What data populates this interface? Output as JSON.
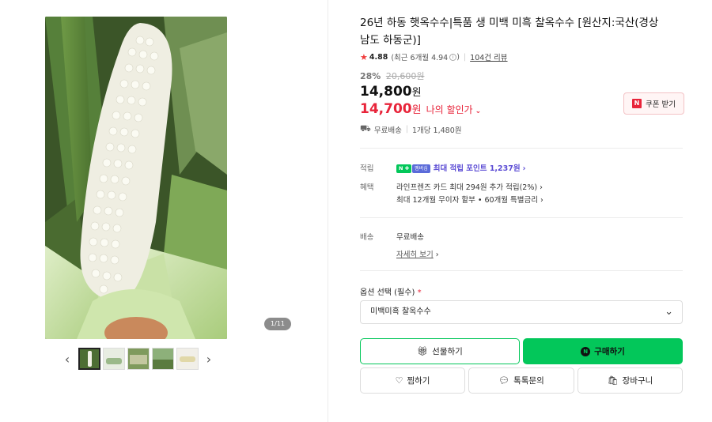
{
  "gallery": {
    "counter": "1/11",
    "prev_arrow": "‹",
    "next_arrow": "›",
    "thumb_count": 5
  },
  "product": {
    "title": "26년 하동 햇옥수수|특품 생 미백 미흑 찰옥수수 [원산지:국산(경상남도 하동군)]",
    "rating": "4.88",
    "rating_recent": "(최근 6개월 4.94",
    "rating_recent_close": ")",
    "review_count": "104건 리뷰",
    "discount": "28%",
    "original_price": "20,600원",
    "price": "14,800",
    "price_unit": "원",
    "my_price": "14,700",
    "my_price_unit": "원",
    "my_price_label": "나의 할인가",
    "coupon_label": "쿠폰 받기",
    "coupon_badge": "N",
    "shipping_free": "무료배송",
    "unit_price": "1개당 1,480원"
  },
  "benefits": {
    "points_label": "적립",
    "points_text": "최대 적립 포인트 1,237원",
    "npay_badge": "N ✚",
    "npay_badge2": "멤버십",
    "benefit_label": "혜택",
    "benefit_1": "라인프렌즈 카드 최대 294원 추가 적립(2%)",
    "benefit_2": "최대 12개월 무이자 할부 • 60개월 특별금리",
    "delivery_label": "배송",
    "delivery_value": "무료배송",
    "delivery_detail": "자세히 보기"
  },
  "option": {
    "label": "옵션 선택 (필수)",
    "required_mark": "*",
    "selected": "미백미흑 찰옥수수"
  },
  "buttons": {
    "gift": "선물하기",
    "buy": "구매하기",
    "buy_badge": "N",
    "wish": "찜하기",
    "talk": "톡톡문의",
    "cart": "장바구니"
  },
  "colors": {
    "naver_green": "#03c75a",
    "price_red": "#e8243a",
    "points_purple": "#5b4bd4"
  }
}
